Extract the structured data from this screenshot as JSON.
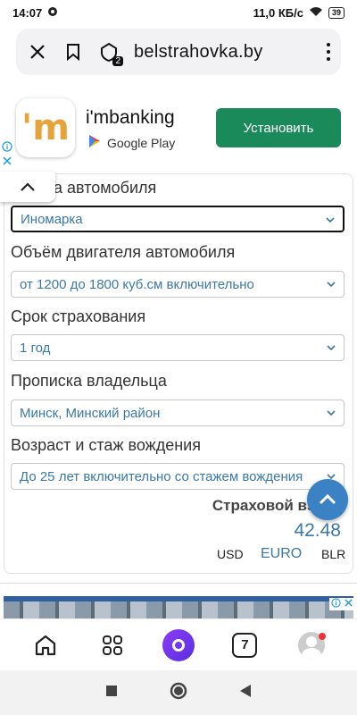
{
  "status_bar": {
    "time": "14:07",
    "network_speed": "11,0 КБ/с",
    "battery": "39"
  },
  "browser": {
    "url": "belstrahovka.by",
    "tab_count_badge": "2"
  },
  "ad_top": {
    "app_name": "i'mbanking",
    "store": "Google Play",
    "install_label": "Установить"
  },
  "form": {
    "fields": [
      {
        "label": "а автомобиля",
        "value": "Иномарка"
      },
      {
        "label": "Объём двигателя автомобиля",
        "value": "от 1200 до 1800 куб.см включительно"
      },
      {
        "label": "Срок страхования",
        "value": "1 год"
      },
      {
        "label": "Прописка владельца",
        "value": "Минск, Минский район"
      },
      {
        "label": "Возраст и стаж вождения",
        "value": "До 25 лет включительно со стажем вождения"
      }
    ],
    "result_label": "Страховой взнос:",
    "result_value": "42.48",
    "currencies": [
      "USD",
      "EURO",
      "BLR"
    ]
  },
  "bottom_nav": {
    "tabs_count": "7"
  },
  "colors": {
    "accent": "#3a78a8",
    "install_button": "#1a8a5a",
    "fab": "#3b82c4",
    "alice": "#6b33ea"
  }
}
